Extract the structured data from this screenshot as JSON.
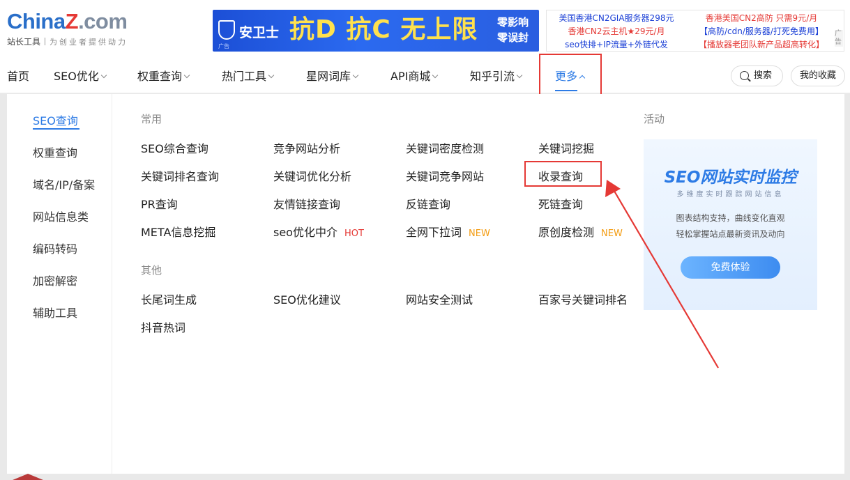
{
  "logo": {
    "part1": "China",
    "part2": "Z",
    "part3": ".com",
    "sub": "站长工具",
    "tagline": "为创业者提供动力"
  },
  "banner": {
    "brand": "安卫士",
    "slogan": "抗D 抗C 无上限",
    "side1": "零影响",
    "side2": "零误封",
    "ad": "广告"
  },
  "text_ads": {
    "left": [
      "美国香港CN2GIA服务器298元",
      "香港CN2云主机★29元/月",
      "seo快排+IP流量+外链代发"
    ],
    "right": [
      "香港美国CN2高防 只需9元/月",
      "【高防/cdn/服务器/打死免费用】",
      "【播放器老团队新产品超高转化】"
    ],
    "mark": "广告"
  },
  "nav": {
    "items": [
      "首页",
      "SEO优化",
      "权重查询",
      "热门工具",
      "星网词库",
      "API商城",
      "知乎引流",
      "更多"
    ],
    "search": "搜索",
    "favorites": "我的收藏"
  },
  "sidebar": [
    "SEO查询",
    "权重查询",
    "域名/IP/备案",
    "网站信息类",
    "编码转码",
    "加密解密",
    "辅助工具"
  ],
  "common": {
    "title": "常用",
    "rows": [
      [
        "SEO综合查询",
        "竞争网站分析",
        "关键词密度检测",
        "关键词挖掘"
      ],
      [
        "关键词排名查询",
        "关键词优化分析",
        "关键词竞争网站",
        "收录查询"
      ],
      [
        "PR查询",
        "友情链接查询",
        "反链查询",
        "死链查询"
      ],
      [
        "META信息挖掘",
        "seo优化中介",
        "全网下拉词",
        "原创度检测"
      ]
    ],
    "tags": {
      "hot": "HOT",
      "new": "NEW"
    }
  },
  "other": {
    "title": "其他",
    "rows": [
      [
        "长尾词生成",
        "SEO优化建议",
        "网站安全测试",
        "百家号关键词排名"
      ],
      [
        "抖音热词"
      ]
    ]
  },
  "activity": {
    "title": "活动",
    "promo_title": "SEO网站实时监控",
    "promo_sub": "多维度实时跟踪网站信息",
    "line1": "图表结构支持，曲线变化直观",
    "line2": "轻松掌握站点最新资讯及动向",
    "button": "免费体验"
  },
  "colors": {
    "accent": "#2d7be5",
    "highlight": "#e53935",
    "hot": "#e53935",
    "new": "#f39c12"
  }
}
